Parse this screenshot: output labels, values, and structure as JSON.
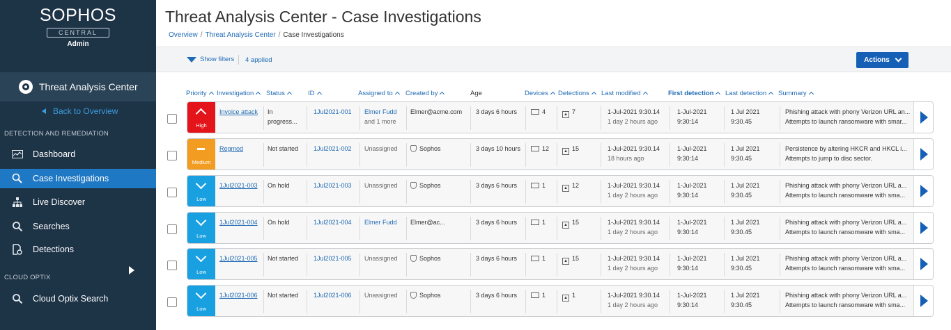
{
  "sidebar": {
    "brand": "SOPHOS",
    "brand_sub": "CENTRAL",
    "role": "Admin",
    "app_title": "Threat Analysis Center",
    "back_link": "Back to Overview",
    "section_detection": "DETECTION AND REMEDIATION",
    "section_cloud": "CLOUD OPTIX",
    "items": [
      {
        "label": "Dashboard",
        "icon": "dashboard-icon",
        "active": false
      },
      {
        "label": "Case Investigations",
        "icon": "investigation-icon",
        "active": true
      },
      {
        "label": "Live Discover",
        "icon": "hierarchy-icon",
        "active": false
      },
      {
        "label": "Searches",
        "icon": "search-icon",
        "active": false
      },
      {
        "label": "Detections",
        "icon": "detection-icon",
        "active": false
      },
      {
        "label": "Cloud Optix Search",
        "icon": "search-icon",
        "active": false
      }
    ]
  },
  "header": {
    "title": "Threat Analysis Center - Case Investigations",
    "breadcrumb": [
      "Overview",
      "Threat Analysis Center",
      "Case Investigations"
    ]
  },
  "toolbar": {
    "show_filters": "Show filters",
    "applied": "4 applied",
    "actions": "Actions"
  },
  "columns": {
    "priority": "Priority",
    "investigation": "Investigation",
    "status": "Status",
    "id": "ID",
    "assigned_to": "Assigned to",
    "created_by": "Created by",
    "age": "Age",
    "devices": "Devices",
    "detections": "Detections",
    "last_modified": "Last modified",
    "first_detection": "First detection",
    "last_detection": "Last detection",
    "summary": "Summary"
  },
  "colors": {
    "high": "#e4141b",
    "medium": "#f39c22",
    "low": "#18a0e0",
    "accent": "#1560b6",
    "sidebar": "#1d3346"
  },
  "rows": [
    {
      "priority": "High",
      "priority_level": "high",
      "investigation": "Invoice attack",
      "status": [
        "In",
        "progress..."
      ],
      "id": "1Jul2021-001",
      "assigned": "Elmer Fudd",
      "assigned_sub": "and 1 more",
      "assigned_link": true,
      "created_by": "Elmer@acme.com",
      "created_by_sophos": false,
      "age": "3 days 6 hours",
      "devices": "4",
      "detections": "7",
      "last_modified": "1-Jul-2021  9:30.14",
      "last_modified_sub": "1 day 2 hours ago",
      "first_detection": [
        "1-Jul-2021",
        "9:30:14"
      ],
      "last_detection": [
        "1 Jul 2021",
        "9:30.45"
      ],
      "summary": [
        "Phishing attack with phony Verizon URL an...",
        "Attempts to launch ransomware with smar..."
      ]
    },
    {
      "priority": "Medium",
      "priority_level": "medium",
      "investigation": "Regmod",
      "status": [
        "Not started",
        ""
      ],
      "id": "1Jul2021-002",
      "assigned": "Unassigned",
      "assigned_sub": "",
      "assigned_link": false,
      "created_by": "Sophos",
      "created_by_sophos": true,
      "age": "3 days 10 hours",
      "devices": "12",
      "detections": "15",
      "last_modified": "1-Jul-2021  9:30.14",
      "last_modified_sub": "18 hours ago",
      "first_detection": [
        "1-Jul-2021",
        "9:30:14"
      ],
      "last_detection": [
        "1 Jul 2021",
        "9:30.45"
      ],
      "summary": [
        "Persistence by altering HKCR and HKCL i...",
        "Attempts to jump to disc sector."
      ]
    },
    {
      "priority": "Low",
      "priority_level": "low",
      "investigation": "1Jul2021-003",
      "status": [
        "On hold",
        ""
      ],
      "id": "1Jul2021-003",
      "assigned": "Unassigned",
      "assigned_sub": "",
      "assigned_link": false,
      "created_by": "Sophos",
      "created_by_sophos": true,
      "age": "3 days 6 hours",
      "devices": "1",
      "detections": "12",
      "last_modified": "1-Jul-2021  9:30.14",
      "last_modified_sub": "1 day 2 hours ago",
      "first_detection": [
        "1-Jul-2021",
        "9:30:14"
      ],
      "last_detection": [
        "1 Jul 2021",
        "9:30.45"
      ],
      "summary": [
        "Phishing attack with phony Verizon URL a...",
        "Attempts to launch ransomware with sma..."
      ]
    },
    {
      "priority": "Low",
      "priority_level": "low",
      "investigation": "1Jul2021-004",
      "status": [
        "On hold",
        ""
      ],
      "id": "1Jul2021-004",
      "assigned": "Elmer Fudd",
      "assigned_sub": "",
      "assigned_link": true,
      "created_by": "Elmer@ac...",
      "created_by_sophos": false,
      "age": "3 days 6 hours",
      "devices": "1",
      "detections": "15",
      "last_modified": "1-Jul-2021  9:30.14",
      "last_modified_sub": "1 day 2 hours ago",
      "first_detection": [
        "1-Jul-2021",
        " 9:30:14"
      ],
      "last_detection": [
        "1 Jul 2021",
        "9:30.45"
      ],
      "summary": [
        "Phishing attack with phony Verizon URL a...",
        "Attempts to launch ransomware with sma..."
      ]
    },
    {
      "priority": "Low",
      "priority_level": "low",
      "investigation": "1Jul2021-005",
      "status": [
        "Not started",
        ""
      ],
      "id": "1Jul2021-005",
      "assigned": "Unassigned",
      "assigned_sub": "",
      "assigned_link": false,
      "created_by": "Sophos",
      "created_by_sophos": true,
      "age": "3 days 6 hours",
      "devices": "1",
      "detections": "15",
      "last_modified": "1-Jul-2021  9:30.14",
      "last_modified_sub": "1 day 2 hours ago",
      "first_detection": [
        "1-Jul-2021",
        " 9:30:14"
      ],
      "last_detection": [
        "1 Jul 2021",
        "9:30.45"
      ],
      "summary": [
        "Phishing attack with phony Verizon URL a...",
        "Attempts to launch ransomware with sma..."
      ]
    },
    {
      "priority": "Low",
      "priority_level": "low",
      "investigation": "1Jul2021-006",
      "status": [
        "Not started",
        ""
      ],
      "id": "1Jul2021-006",
      "assigned": "Unassigned",
      "assigned_sub": "",
      "assigned_link": false,
      "created_by": "Sophos",
      "created_by_sophos": true,
      "age": "3 days 6 hours",
      "devices": "1",
      "detections": "1",
      "last_modified": "1-Jul-2021  9:30.14",
      "last_modified_sub": "1 day 2 hours ago",
      "first_detection": [
        "1-Jul-2021",
        "9:30:14"
      ],
      "last_detection": [
        "1 Jul 2021",
        "9:30.45"
      ],
      "summary": [
        "Phishing attack with phony Verizon URL a...",
        "Attempts to launch ransomware with sma..."
      ]
    }
  ]
}
